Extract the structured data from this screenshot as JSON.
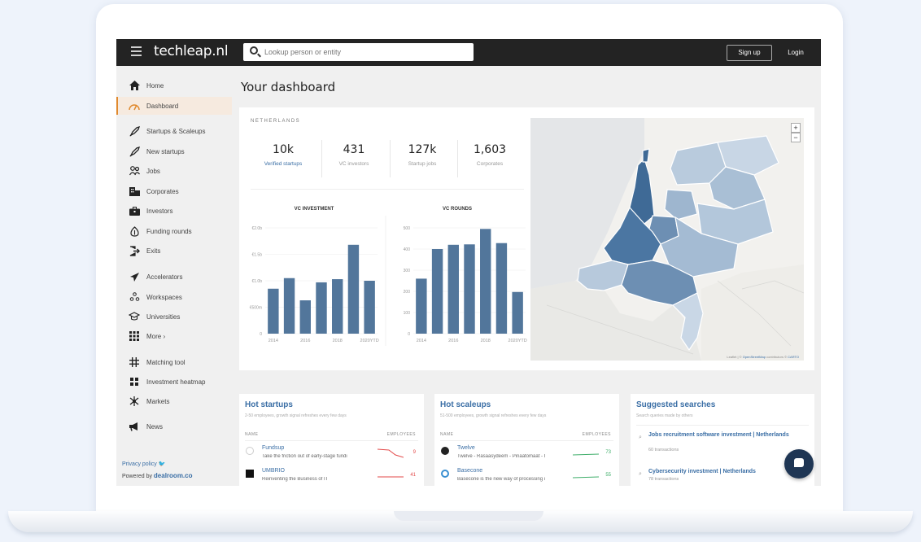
{
  "topbar": {
    "brand": "techleap.nl",
    "search_placeholder": "Lookup person or entity",
    "signup_label": "Sign up",
    "login_label": "Login"
  },
  "sidebar": {
    "items": [
      {
        "label": "Home",
        "icon": "home-icon"
      },
      {
        "label": "Dashboard",
        "icon": "dashboard-icon"
      },
      {
        "label": "Startups & Scaleups",
        "icon": "rocket-icon"
      },
      {
        "label": "New startups",
        "icon": "rocket-icon"
      },
      {
        "label": "Jobs",
        "icon": "people-icon"
      },
      {
        "label": "Corporates",
        "icon": "building-icon"
      },
      {
        "label": "Investors",
        "icon": "briefcase-icon"
      },
      {
        "label": "Funding rounds",
        "icon": "money-icon"
      },
      {
        "label": "Exits",
        "icon": "exit-icon"
      },
      {
        "label": "Accelerators",
        "icon": "plane-icon"
      },
      {
        "label": "Workspaces",
        "icon": "workspace-icon"
      },
      {
        "label": "Universities",
        "icon": "graduation-icon"
      },
      {
        "label": "More ›",
        "icon": "grid-icon"
      },
      {
        "label": "Matching tool",
        "icon": "matching-icon"
      },
      {
        "label": "Investment heatmap",
        "icon": "heatmap-icon"
      },
      {
        "label": "Markets",
        "icon": "markets-icon"
      },
      {
        "label": "News",
        "icon": "megaphone-icon"
      }
    ],
    "privacy": "Privacy policy",
    "powered_by": "Powered by",
    "powered_brand": "dealroom.co"
  },
  "main": {
    "title": "Your dashboard",
    "country": "NETHERLANDS",
    "stats": [
      {
        "value": "10k",
        "label": "Verified startups"
      },
      {
        "value": "431",
        "label": "VC investors"
      },
      {
        "value": "127k",
        "label": "Startup jobs"
      },
      {
        "value": "1,603",
        "label": "Corporates"
      }
    ],
    "map_attribution_prefix": "Leaflet | © ",
    "map_attribution_osm": "OpenStreetMap",
    "map_attribution_mid": " contributors © ",
    "map_attribution_carto": "CARTO"
  },
  "chart_data": [
    {
      "type": "bar",
      "title": "VC INVESTMENT",
      "categories": [
        "2014",
        "2015",
        "2016",
        "2017",
        "2018",
        "2019",
        "2020YTD"
      ],
      "tick_labels_x": [
        "2014",
        "2016",
        "2018",
        "2020YTD"
      ],
      "values": [
        0.85,
        1.05,
        0.63,
        0.97,
        1.03,
        1.68,
        1.0
      ],
      "yticks": [
        "0",
        "€500m",
        "€1.0b",
        "€1.5b",
        "€2.0b"
      ],
      "ylim": [
        0,
        2.0
      ],
      "color": "#52769b"
    },
    {
      "type": "bar",
      "title": "VC ROUNDS",
      "categories": [
        "2014",
        "2015",
        "2016",
        "2017",
        "2018",
        "2019",
        "2020YTD"
      ],
      "tick_labels_x": [
        "2014",
        "2016",
        "2018",
        "2020YTD"
      ],
      "values": [
        260,
        400,
        420,
        422,
        495,
        428,
        197
      ],
      "yticks": [
        "0",
        "100",
        "200",
        "300",
        "400",
        "500"
      ],
      "ylim": [
        0,
        500
      ],
      "color": "#52769b"
    }
  ],
  "hot_startups": {
    "title": "Hot startups",
    "subtitle": "2-50 employees, growth signal refreshes every few days",
    "col_name": "NAME",
    "col_employees": "EMPLOYEES",
    "rows": [
      {
        "name": "Fundsup",
        "desc": "Take the friction out of early-stage fundi",
        "value": "9"
      },
      {
        "name": "UMBRIO",
        "desc": "Reinventing the Business of IT",
        "value": "41"
      }
    ]
  },
  "hot_scaleups": {
    "title": "Hot scaleups",
    "subtitle": "51-500 employees, growth signal refreshes every few days",
    "col_name": "NAME",
    "col_employees": "EMPLOYEES",
    "rows": [
      {
        "name": "Twelve",
        "desc": "Twelve - Rasaasydeem - Pinaatomaat - I",
        "value": "73"
      },
      {
        "name": "Basecone",
        "desc": "Basecone is the new way of processing i",
        "value": "55"
      }
    ]
  },
  "suggested": {
    "title": "Suggested searches",
    "subtitle": "Search queries made by others",
    "items": [
      {
        "name": "Jobs recruitment software investment | Netherlands",
        "sub": "60 transactions"
      },
      {
        "name": "Cybersecurity investment | Netherlands",
        "sub": "78 transactions"
      }
    ]
  },
  "colors": {
    "accent": "#e08a2f",
    "link": "#3a6ea5",
    "bar": "#52769b",
    "topbar": "#232323"
  }
}
